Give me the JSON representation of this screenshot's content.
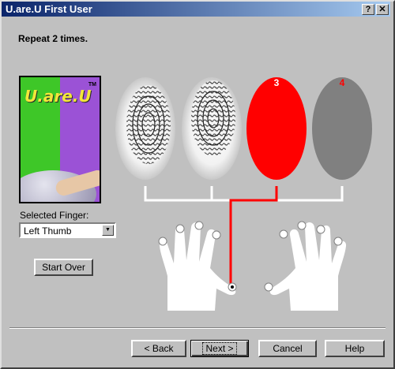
{
  "window": {
    "title": "U.are.U First User",
    "help_label": "?",
    "close_label": "✕"
  },
  "instruction": "Repeat 2 times.",
  "logo": {
    "text": "U.are.U",
    "trademark": "TM"
  },
  "finger_select": {
    "label": "Selected Finger:",
    "value": "Left Thumb"
  },
  "buttons": {
    "start_over": "Start Over",
    "back": "< Back",
    "next": "Next >",
    "cancel": "Cancel",
    "help": "Help"
  },
  "scans": [
    {
      "state": "captured",
      "label": ""
    },
    {
      "state": "captured",
      "label": ""
    },
    {
      "state": "current",
      "label": "3",
      "color": "#ff0000"
    },
    {
      "state": "pending",
      "label": "4",
      "color": "#808080"
    }
  ],
  "label_color": "#ff0000",
  "selected_finger_index": 0
}
